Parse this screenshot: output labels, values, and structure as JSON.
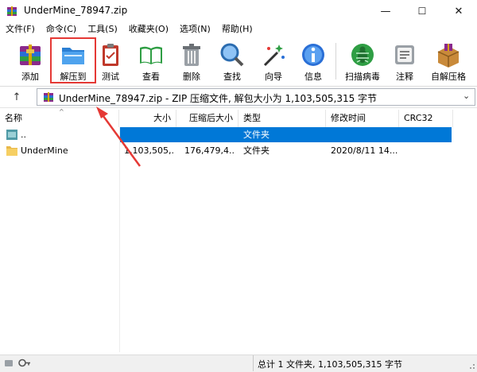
{
  "window": {
    "title": "UnderMine_78947.zip",
    "controls": {
      "minimize": "—",
      "maximize": "☐",
      "close": "✕"
    }
  },
  "menu": [
    "文件(F)",
    "命令(C)",
    "工具(S)",
    "收藏夹(O)",
    "选项(N)",
    "帮助(H)"
  ],
  "toolbar": {
    "add": "添加",
    "extract_to": "解压到",
    "test": "测试",
    "view": "查看",
    "delete": "删除",
    "find": "查找",
    "wizard": "向导",
    "info": "信息",
    "virus_scan": "扫描病毒",
    "comment": "注释",
    "sfx": "自解压格"
  },
  "address": {
    "text": "UnderMine_78947.zip - ZIP 压缩文件, 解包大小为 1,103,505,315 字节"
  },
  "columns": [
    "名称",
    "大小",
    "压缩后大小",
    "类型",
    "修改时间",
    "CRC32"
  ],
  "rows": [
    {
      "name": "..",
      "size": "",
      "packed": "",
      "type": "文件夹",
      "modified": "",
      "crc": ""
    },
    {
      "name": "UnderMine",
      "size": "1,103,505,...",
      "packed": "176,479,4...",
      "type": "文件夹",
      "modified": "2020/8/11 14...",
      "crc": ""
    }
  ],
  "status": {
    "text": "总计 1 文件夹, 1,103,505,315 字节"
  },
  "colors": {
    "highlight_border": "#e53935",
    "selected_row": "#0078d7",
    "arrow": "#e53935"
  }
}
